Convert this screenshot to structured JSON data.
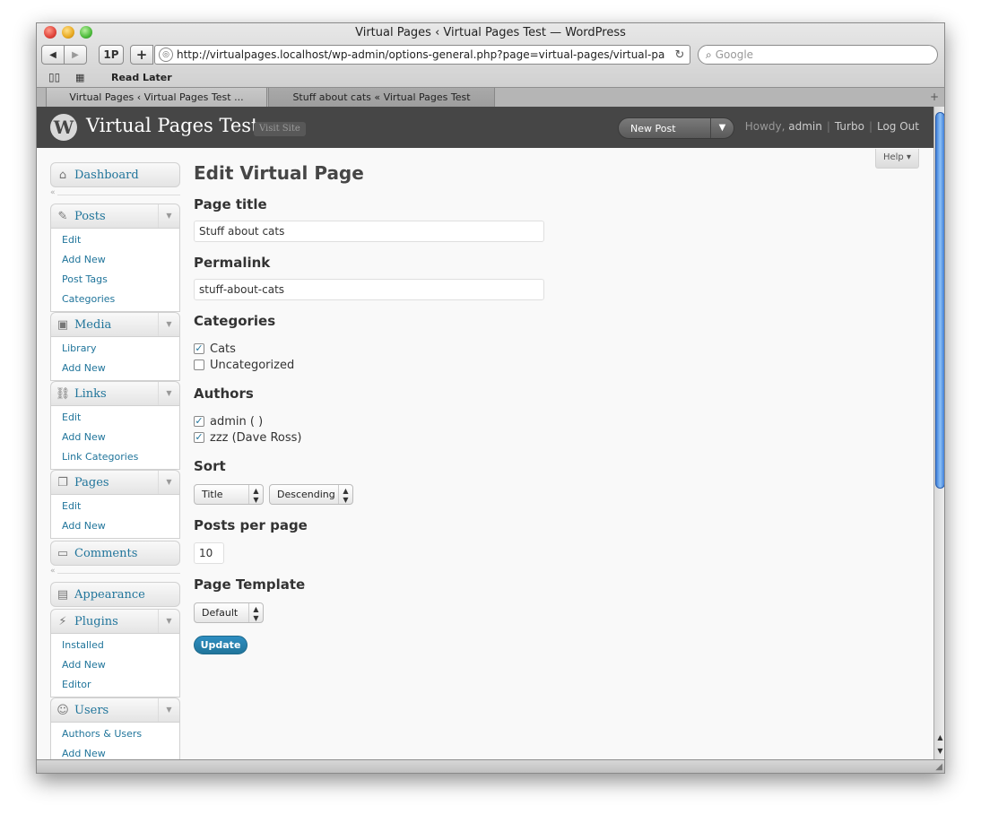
{
  "browser": {
    "window_title": "Virtual Pages ‹ Virtual Pages Test — WordPress",
    "back_button": "◀",
    "forward_button": "▶",
    "onepassword": "1P",
    "add_button": "+",
    "url": "http://virtualpages.localhost/wp-admin/options-general.php?page=virtual-pages/virtual-pa",
    "search_placeholder": "Google",
    "bookmarks": [
      "Read Later"
    ],
    "tabs": [
      {
        "label": "Virtual Pages ‹ Virtual Pages Test ...",
        "active": true
      },
      {
        "label": "Stuff about cats « Virtual Pages Test",
        "active": false
      }
    ]
  },
  "header": {
    "site_name": "Virtual Pages Test",
    "visit_site": "Visit Site",
    "new_post": "New Post",
    "howdy": "Howdy,",
    "user": "admin",
    "turbo": "Turbo",
    "logout": "Log Out",
    "help": "Help"
  },
  "sidebar": {
    "dashboard": "Dashboard",
    "posts": {
      "label": "Posts",
      "items": [
        "Edit",
        "Add New",
        "Post Tags",
        "Categories"
      ]
    },
    "media": {
      "label": "Media",
      "items": [
        "Library",
        "Add New"
      ]
    },
    "links": {
      "label": "Links",
      "items": [
        "Edit",
        "Add New",
        "Link Categories"
      ]
    },
    "pages": {
      "label": "Pages",
      "items": [
        "Edit",
        "Add New"
      ]
    },
    "comments": "Comments",
    "appearance": "Appearance",
    "plugins": {
      "label": "Plugins",
      "items": [
        "Installed",
        "Add New",
        "Editor"
      ]
    },
    "users": {
      "label": "Users",
      "items": [
        "Authors & Users",
        "Add New"
      ]
    }
  },
  "form": {
    "heading": "Edit Virtual Page",
    "page_title_label": "Page title",
    "page_title_value": "Stuff about cats",
    "permalink_label": "Permalink",
    "permalink_value": "stuff-about-cats",
    "categories_label": "Categories",
    "categories": [
      {
        "label": "Cats",
        "checked": true
      },
      {
        "label": "Uncategorized",
        "checked": false
      }
    ],
    "authors_label": "Authors",
    "authors": [
      {
        "label": "admin ( )",
        "checked": true
      },
      {
        "label": "zzz (Dave Ross)",
        "checked": true
      }
    ],
    "sort_label": "Sort",
    "sort_field": "Title",
    "sort_order": "Descending",
    "posts_per_page_label": "Posts per page",
    "posts_per_page_value": "10",
    "template_label": "Page Template",
    "template_value": "Default",
    "update_button": "Update"
  },
  "colors": {
    "link": "#21759b",
    "header_bg": "#464646",
    "update_button": "#21759b"
  }
}
